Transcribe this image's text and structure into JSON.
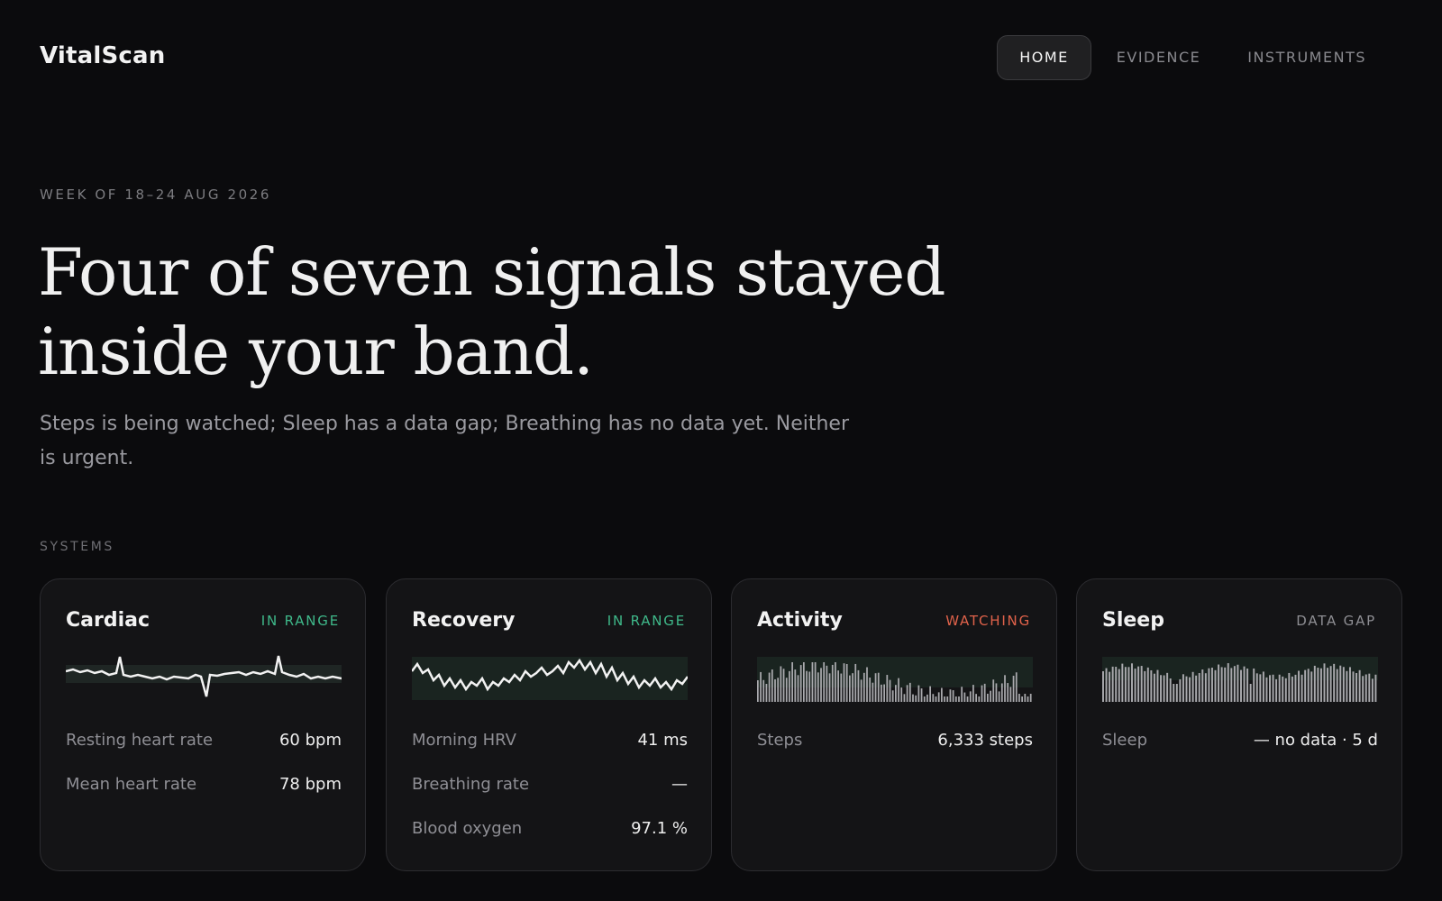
{
  "app": {
    "brand": "VitalScan"
  },
  "nav": {
    "items": [
      {
        "label": "HOME",
        "active": true
      },
      {
        "label": "EVIDENCE",
        "active": false
      },
      {
        "label": "INSTRUMENTS",
        "active": false
      }
    ]
  },
  "hero": {
    "eyebrow": "WEEK OF 18–24 AUG 2026",
    "headline": "Four of seven signals stayed inside your band.",
    "subline": "Steps is being watched; Sleep has a data gap; Breathing has no data yet. Neither is urgent."
  },
  "systems": {
    "label": "SYSTEMS",
    "cards": [
      {
        "title": "Cardiac",
        "status": "IN RANGE",
        "status_color": "#3fb98a",
        "spark_kind": "line",
        "metrics": [
          {
            "label": "Resting heart rate",
            "value": "60 bpm"
          },
          {
            "label": "Mean heart rate",
            "value": "78 bpm"
          }
        ]
      },
      {
        "title": "Recovery",
        "status": "IN RANGE",
        "status_color": "#3fb98a",
        "spark_kind": "line",
        "metrics": [
          {
            "label": "Morning HRV",
            "value": "41 ms"
          },
          {
            "label": "Breathing rate",
            "value": "—"
          },
          {
            "label": "Blood oxygen",
            "value": "97.1 %"
          }
        ]
      },
      {
        "title": "Activity",
        "status": "WATCHING",
        "status_color": "#e0624a",
        "spark_kind": "bars",
        "metrics": [
          {
            "label": "Steps",
            "value": "6,333 steps"
          }
        ]
      },
      {
        "title": "Sleep",
        "status": "DATA GAP",
        "status_color": "#8e8e93",
        "spark_kind": "bars",
        "metrics": [
          {
            "label": "Sleep",
            "value": "— no data · 5 d"
          }
        ]
      }
    ]
  }
}
